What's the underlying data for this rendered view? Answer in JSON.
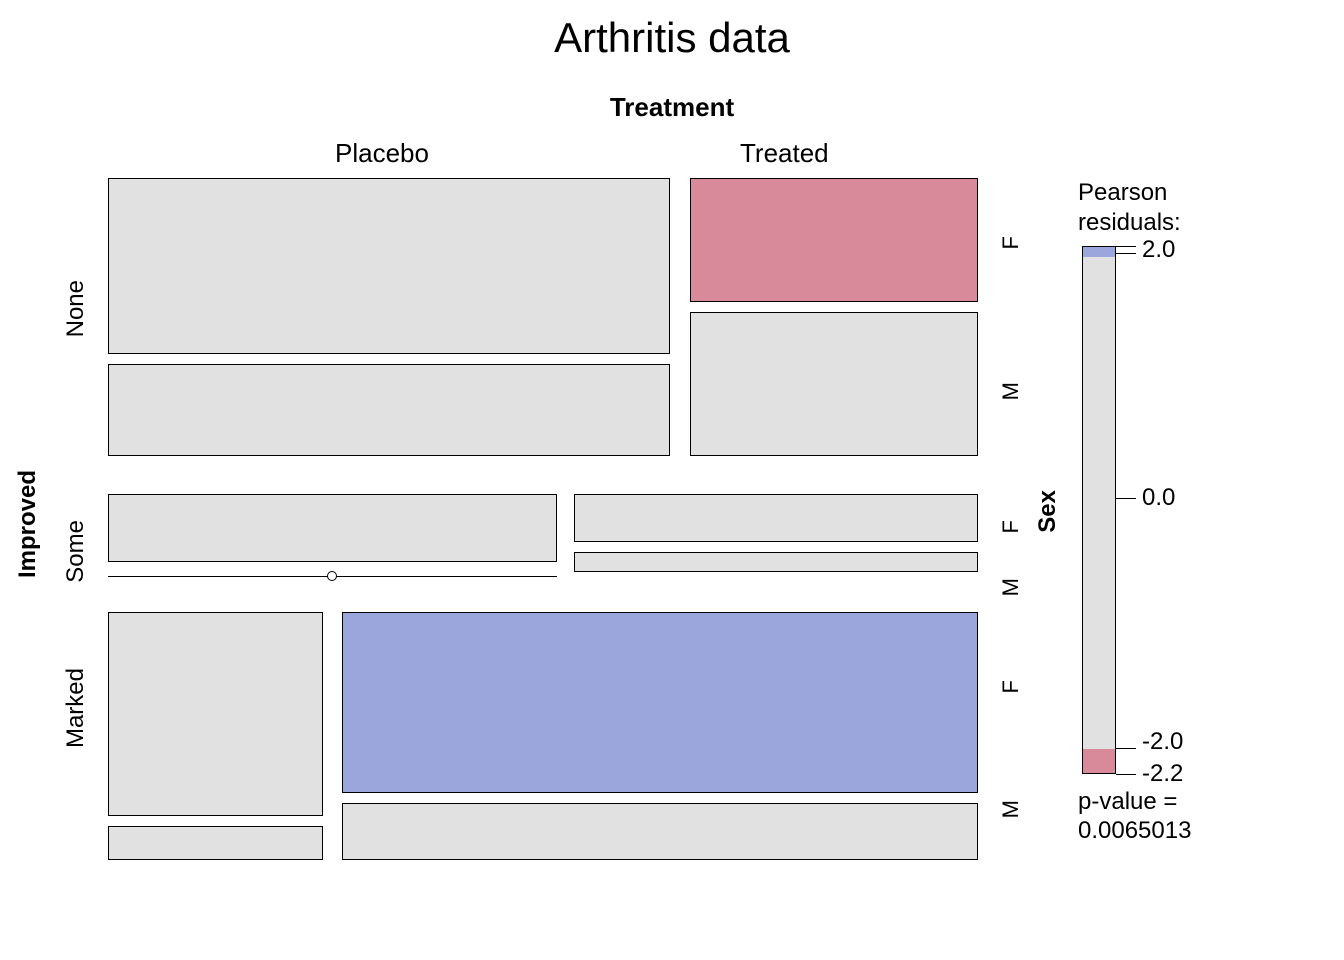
{
  "title": "Arthritis data",
  "axes": {
    "top_label": "Treatment",
    "left_label": "Improved",
    "right_label": "Sex",
    "treatment_levels": [
      "Placebo",
      "Treated"
    ],
    "improved_levels": [
      "None",
      "Some",
      "Marked"
    ],
    "sex_levels": [
      "F",
      "M"
    ]
  },
  "legend": {
    "title_line1": "Pearson",
    "title_line2": "residuals:",
    "ticks": [
      "2.0",
      "0.0",
      "-2.0",
      "-2.2"
    ],
    "pvalue_label": "p-value =",
    "pvalue": "0.0065013"
  },
  "colors": {
    "neutral": "#e1e1e1",
    "positive": "#9aa6dc",
    "negative": "#d98a9a"
  },
  "chart_data": {
    "type": "mosaic",
    "title": "Arthritis data",
    "p_value": 0.0065013,
    "residual_scale": [
      -2.2,
      2.0
    ],
    "dimensions": {
      "Improved": [
        "None",
        "Some",
        "Marked"
      ],
      "Treatment": [
        "Placebo",
        "Treated"
      ],
      "Sex": [
        "Female",
        "Male"
      ]
    },
    "counts": [
      {
        "Treatment": "Placebo",
        "Sex": "Female",
        "Improved": "None",
        "n": 19,
        "residual_bin": "neutral"
      },
      {
        "Treatment": "Placebo",
        "Sex": "Female",
        "Improved": "Some",
        "n": 7,
        "residual_bin": "neutral"
      },
      {
        "Treatment": "Placebo",
        "Sex": "Female",
        "Improved": "Marked",
        "n": 6,
        "residual_bin": "neutral"
      },
      {
        "Treatment": "Placebo",
        "Sex": "Male",
        "Improved": "None",
        "n": 10,
        "residual_bin": "neutral"
      },
      {
        "Treatment": "Placebo",
        "Sex": "Male",
        "Improved": "Some",
        "n": 0,
        "residual_bin": "neutral"
      },
      {
        "Treatment": "Placebo",
        "Sex": "Male",
        "Improved": "Marked",
        "n": 1,
        "residual_bin": "neutral"
      },
      {
        "Treatment": "Treated",
        "Sex": "Female",
        "Improved": "None",
        "n": 6,
        "residual_bin": "negative"
      },
      {
        "Treatment": "Treated",
        "Sex": "Female",
        "Improved": "Some",
        "n": 5,
        "residual_bin": "neutral"
      },
      {
        "Treatment": "Treated",
        "Sex": "Female",
        "Improved": "Marked",
        "n": 16,
        "residual_bin": "positive"
      },
      {
        "Treatment": "Treated",
        "Sex": "Male",
        "Improved": "None",
        "n": 7,
        "residual_bin": "neutral"
      },
      {
        "Treatment": "Treated",
        "Sex": "Male",
        "Improved": "Some",
        "n": 2,
        "residual_bin": "neutral"
      },
      {
        "Treatment": "Treated",
        "Sex": "Male",
        "Improved": "Marked",
        "n": 5,
        "residual_bin": "neutral"
      }
    ]
  }
}
